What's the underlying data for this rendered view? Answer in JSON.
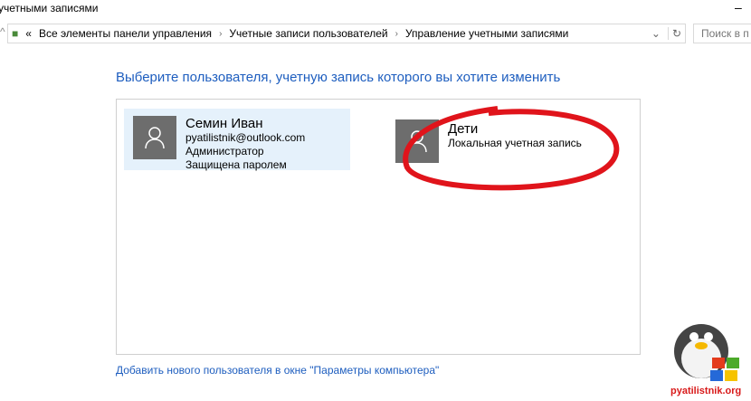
{
  "window": {
    "title": "учетными записями"
  },
  "address_bar": {
    "breadcrumbs": [
      "Все элементы панели управления",
      "Учетные записи пользователей",
      "Управление учетными записями"
    ],
    "overflow": "«"
  },
  "search": {
    "placeholder": "Поиск в п"
  },
  "heading": "Выберите пользователя, учетную запись которого вы хотите изменить",
  "accounts": [
    {
      "name": "Семин Иван",
      "email": "pyatilistnik@outlook.com",
      "role": "Администратор",
      "status": "Защищена паролем",
      "selected": true
    },
    {
      "name": "Дети",
      "type": "Локальная учетная запись"
    }
  ],
  "add_user_link": "Добавить нового пользователя в окне \"Параметры компьютера\"",
  "watermark": "pyatilistnik.org",
  "colors": {
    "link": "#1e5ebf",
    "selected": "#e5f1fb",
    "annotation": "#e0141b"
  }
}
